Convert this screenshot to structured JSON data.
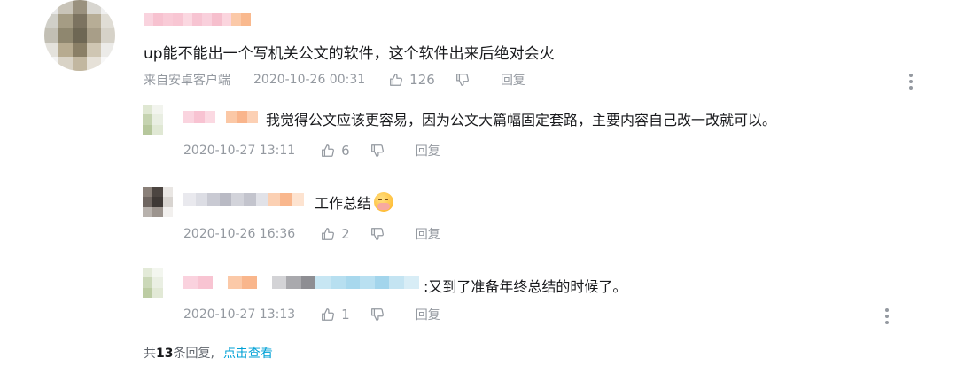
{
  "main_comment": {
    "content": "up能不能出一个写机关公文的软件，这个软件出来后绝对会火",
    "source": "来自安卓客户端",
    "time": "2020-10-26 00:31",
    "likes": "126",
    "reply_label": "回复",
    "avatar_colors": [
      "#e8e8e8",
      "#c9c4b8",
      "#9a917e",
      "#d8d6d0",
      "#f0f0f0",
      "#d0cfc8",
      "#a59c84",
      "#7c7360",
      "#b7ad96",
      "#e0ddd5",
      "#c2bfb4",
      "#8f876f",
      "#6e6754",
      "#a89e88",
      "#d6d2c8",
      "#e4e2dc",
      "#b7ab90",
      "#8a7f66",
      "#cfc6b3",
      "#ecebe8",
      "#f4f4f4",
      "#d9d3c6",
      "#c2b7a0",
      "#e6e1d8",
      "#f8f8f8"
    ],
    "name_colors": [
      "#f9d3de",
      "#f7c2d0",
      "#f9cbd7",
      "#f8c6d3",
      "#fbd8e1",
      "#f7c4d2",
      "#f9d0dc",
      "#f6bfcd",
      "#fbd5de",
      "#fbc9a8",
      "#f9b98e"
    ]
  },
  "replies": [
    {
      "content": "我觉得公文应该更容易，因为公文大篇幅固定套路，主要内容自己改一改就可以。",
      "time": "2020-10-27 13:11",
      "likes": "6",
      "reply_label": "回复",
      "avatar_colors": [
        "#dfe7d2",
        "#f2f4ee",
        "#ffffff",
        "#c5d3b0",
        "#e9eee2",
        "#ffffff",
        "#b6c79c",
        "#e0e8d4",
        "#ffffff"
      ],
      "name_colors": [
        "#fad4df",
        "#f8c3d2",
        "#fbd9e2",
        "#ffffff",
        "#fbc8a6",
        "#f9b58c",
        "#fcd0b4"
      ]
    },
    {
      "content": "工作总结",
      "time": "2020-10-26 16:36",
      "likes": "2",
      "reply_label": "回复",
      "avatar_colors": [
        "#8a8079",
        "#4c4541",
        "#e9e6e3",
        "#6f6661",
        "#3e3835",
        "#d8d4d0",
        "#b8b2ad",
        "#9c948e",
        "#f2f0ee"
      ],
      "name_colors": [
        "#e9e9ee",
        "#dcdde4",
        "#c9cad3",
        "#b9bac4",
        "#d2d3da",
        "#c3c4cd",
        "#e1e2e8",
        "#fbd0b3",
        "#f9b78d",
        "#fde3d0"
      ]
    },
    {
      "content": ":又到了准备年终总结的时候了。",
      "time": "2020-10-27 13:13",
      "likes": "1",
      "reply_label": "回复",
      "avatar_colors": [
        "#e3ead8",
        "#f3f6ef",
        "#ffffff",
        "#cbd8b8",
        "#eaefe3",
        "#ffffff",
        "#bccca3",
        "#e2e9d6",
        "#ffffff"
      ],
      "name_colors": [
        "#fad2de",
        "#f8c4d2",
        "#ffffff",
        "#fbc9a8",
        "#f9b68c",
        "#ffffff",
        "#d3d3d6",
        "#a9a9ad",
        "#8e8e93",
        "#c7e6f3",
        "#b7dff0",
        "#a8d8ed",
        "#b9e0f1",
        "#a3d5ec",
        "#c4e4f2",
        "#d8edf6"
      ]
    }
  ],
  "summary": {
    "prefix": "共",
    "count": "13",
    "suffix": "条回复,",
    "link": "点击查看"
  },
  "icons": {
    "like": "thumbs-up-icon",
    "dislike": "thumbs-down-icon",
    "more": "more-vertical-icon"
  }
}
